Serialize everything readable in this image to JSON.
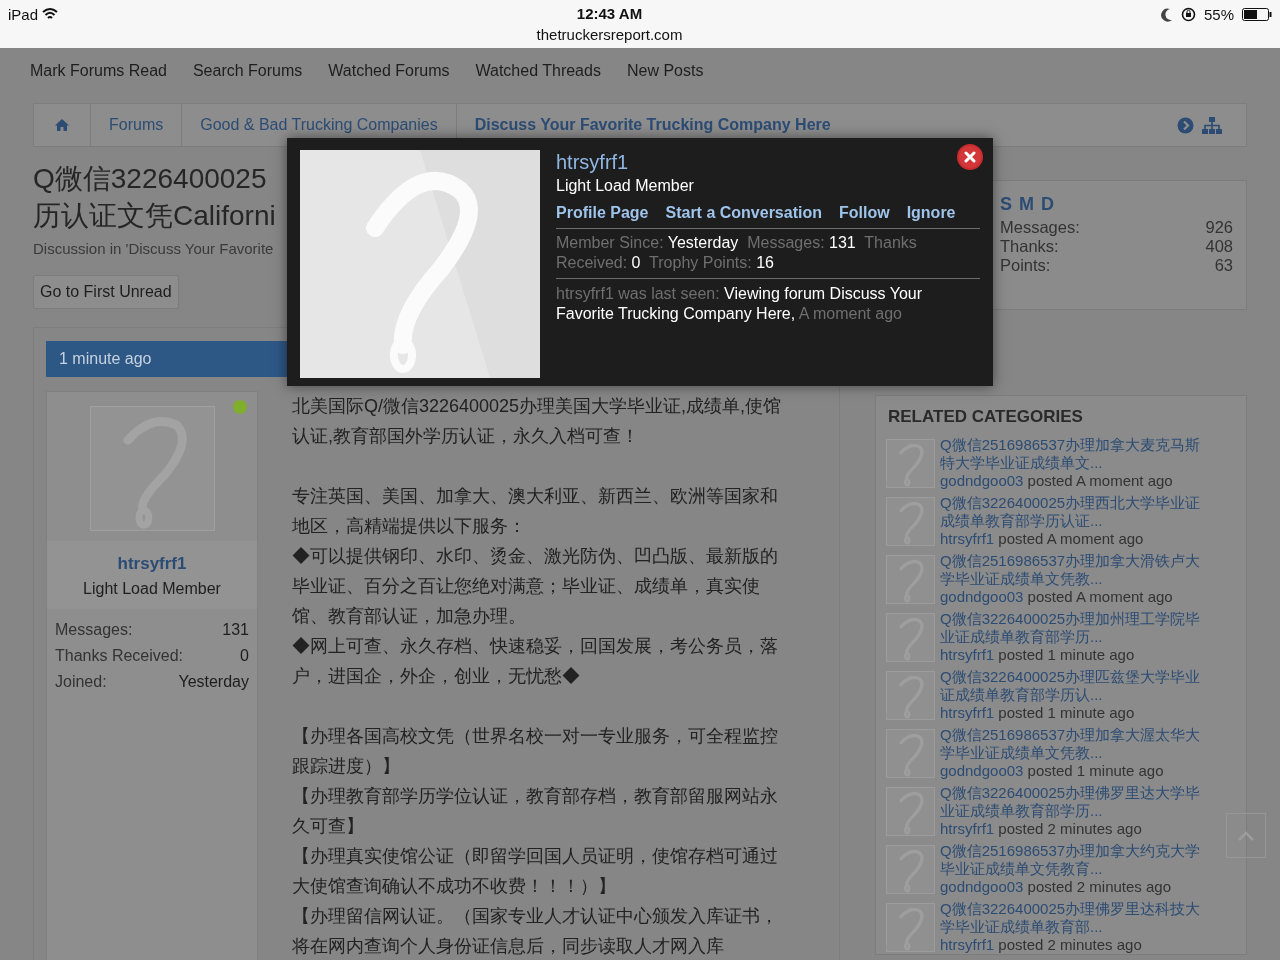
{
  "status_bar": {
    "device": "iPad",
    "time": "12:43 AM",
    "url": "thetruckersreport.com",
    "battery": "55%"
  },
  "nav": [
    {
      "label": "Mark Forums Read"
    },
    {
      "label": "Search Forums"
    },
    {
      "label": "Watched Forums"
    },
    {
      "label": "Watched Threads"
    },
    {
      "label": "New Posts"
    }
  ],
  "breadcrumb": [
    {
      "label": "Forums",
      "current": false
    },
    {
      "label": "Good & Bad Trucking Companies",
      "current": false
    },
    {
      "label": "Discuss Your Favorite Trucking Company Here",
      "current": true
    }
  ],
  "thread": {
    "title_lines": [
      "Q微信3226400025",
      "历认证文凭Californi"
    ],
    "meta": "Discussion in 'Discuss Your Favorite",
    "first_unread": "Go to First Unread"
  },
  "post": {
    "time": "1 minute ago",
    "author": {
      "name": "htrsyfrf1",
      "title": "Light Load Member",
      "online": true,
      "stats": [
        {
          "label": "Messages:",
          "value": "131"
        },
        {
          "label": "Thanks Received:",
          "value": "0"
        },
        {
          "label": "Joined:",
          "value": "Yesterday"
        }
      ]
    },
    "body": [
      [
        "北美国际Q/微信3226400025办理美国大学毕业证,成绩单,使馆认证,教育部国外学历认证，永久入档可查！"
      ],
      [
        "专注英国、美国、加拿大、澳大利亚、新西兰、欧洲等国家和地区，高精端提供以下服务：",
        "◆可以提供钢印、水印、烫金、激光防伪、凹凸版、最新版的毕业证、百分之百让您绝对满意；毕业证、成绩单，真实使馆、教育部认证，加急办理。",
        "◆网上可查、永久存档、快速稳妥，回国发展，考公务员，落户，进国企，外企，创业，无忧愁◆"
      ],
      [
        "【办理各国高校文凭（世界名校一对一专业服务，可全程监控跟踪进度）】",
        "【办理教育部学历学位认证，教育部存档，教育部留服网站永久可查】",
        "【办理真实使馆公证（即留学回国人员证明，使馆存档可通过大使馆查询确认不成功不收费！！！）】",
        "【办理留信网认证。（国家专业人才认证中心颁发入库证书，将在网内查询个人身份证信息后，同步读取人才网入库"
      ]
    ]
  },
  "sidebar": {
    "profile": {
      "name": "S M D",
      "stats": [
        {
          "label": "Messages:",
          "value": "926"
        },
        {
          "label": "Thanks:",
          "value": "408"
        },
        {
          "label": "Points:",
          "value": "63"
        }
      ]
    },
    "related": {
      "title": "RELATED CATEGORIES",
      "items": [
        {
          "title": "Q微信2516986537办理加拿大麦克马斯特大学毕业证成绩单文...",
          "author": "godndgoo03",
          "when": "posted A moment ago"
        },
        {
          "title": "Q微信3226400025办理西北大学毕业证成绩单教育部学历认证...",
          "author": "htrsyfrf1",
          "when": "posted A moment ago"
        },
        {
          "title": "Q微信2516986537办理加拿大滑铁卢大学毕业证成绩单文凭教...",
          "author": "godndgoo03",
          "when": "posted A moment ago"
        },
        {
          "title": "Q微信3226400025办理加州理工学院毕业证成绩单教育部学历...",
          "author": "htrsyfrf1",
          "when": "posted 1 minute ago"
        },
        {
          "title": "Q微信3226400025办理匹兹堡大学毕业证成绩单教育部学历认...",
          "author": "htrsyfrf1",
          "when": "posted 1 minute ago"
        },
        {
          "title": "Q微信2516986537办理加拿大渥太华大学毕业证成绩单文凭教...",
          "author": "godndgoo03",
          "when": "posted 1 minute ago"
        },
        {
          "title": "Q微信3226400025办理佛罗里达大学毕业证成绩单教育部学历...",
          "author": "htrsyfrf1",
          "when": "posted 2 minutes ago"
        },
        {
          "title": "Q微信2516986537办理加拿大约克大学毕业证成绩单文凭教育...",
          "author": "godndgoo03",
          "when": "posted 2 minutes ago"
        },
        {
          "title": "Q微信3226400025办理佛罗里达科技大学毕业证成绩单教育部...",
          "author": "htrsyfrf1",
          "when": "posted 2 minutes ago"
        }
      ]
    }
  },
  "popup": {
    "name": "htrsyfrf1",
    "title": "Light Load Member",
    "links": [
      "Profile Page",
      "Start a Conversation",
      "Follow",
      "Ignore"
    ],
    "stats": [
      {
        "label": "Member Since:",
        "value": "Yesterday"
      },
      {
        "label": "Messages:",
        "value": "131"
      },
      {
        "label": "Thanks Received:",
        "value": "0"
      },
      {
        "label": "Trophy Points:",
        "value": "16"
      }
    ],
    "last_seen": {
      "label": "htrsyfrf1 was last seen:",
      "activity": "Viewing forum Discuss Your Favorite Trucking Company Here,",
      "when": "A moment ago"
    }
  }
}
